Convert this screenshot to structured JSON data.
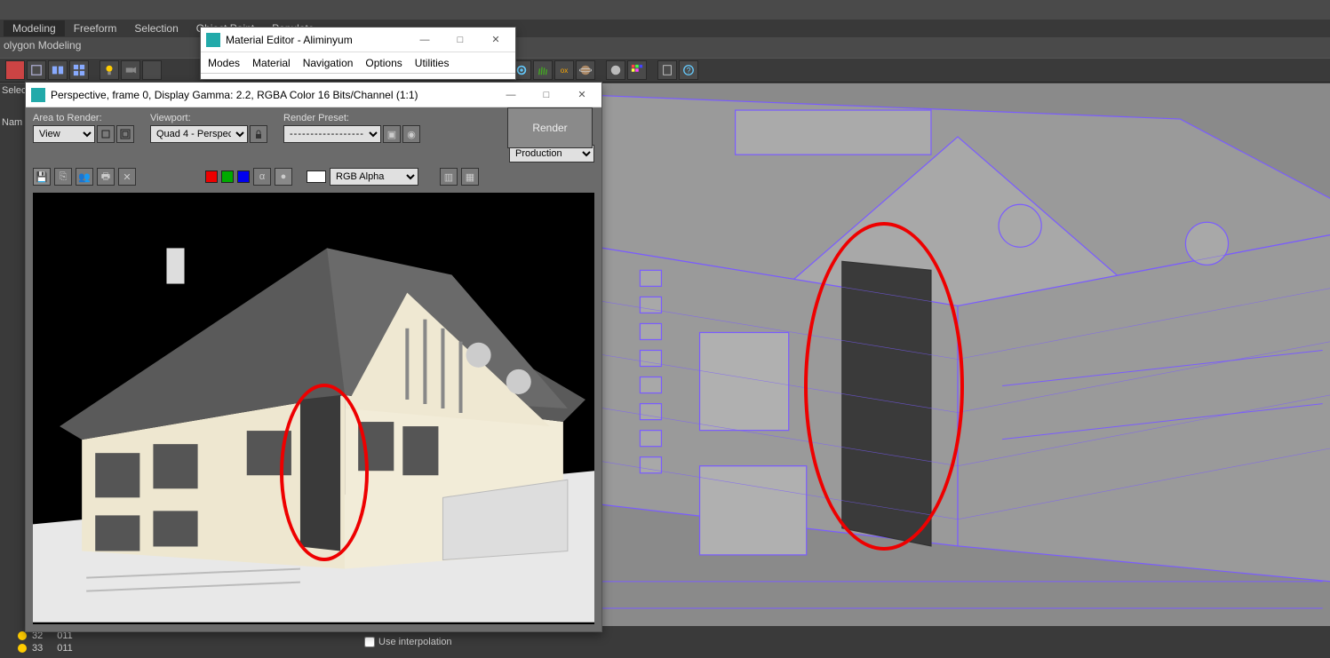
{
  "main_menu": {
    "tabs": [
      "Modeling",
      "Freeform",
      "Selection",
      "Object Paint",
      "Populate"
    ],
    "active_index": 0,
    "sub_label": "olygon Modeling"
  },
  "left_panel": {
    "select_label": "Select",
    "name_label": "Nam"
  },
  "material_editor": {
    "title": "Material Editor - Aliminyum",
    "menu": [
      "Modes",
      "Material",
      "Navigation",
      "Options",
      "Utilities"
    ]
  },
  "render_window": {
    "title": "Perspective, frame 0, Display Gamma: 2.2, RGBA Color 16 Bits/Channel (1:1)",
    "area_label": "Area to Render:",
    "area_value": "View",
    "viewport_label": "Viewport:",
    "viewport_value": "Quad 4 - Perspec",
    "preset_label": "Render Preset:",
    "preset_value": "---------------------------",
    "render_btn": "Render",
    "output_mode": "Production",
    "channel": "RGB Alpha"
  },
  "bottom": {
    "row1_a": "32",
    "row1_b": "011",
    "row2_a": "33",
    "row2_b": "011",
    "interp": "Use interpolation"
  }
}
